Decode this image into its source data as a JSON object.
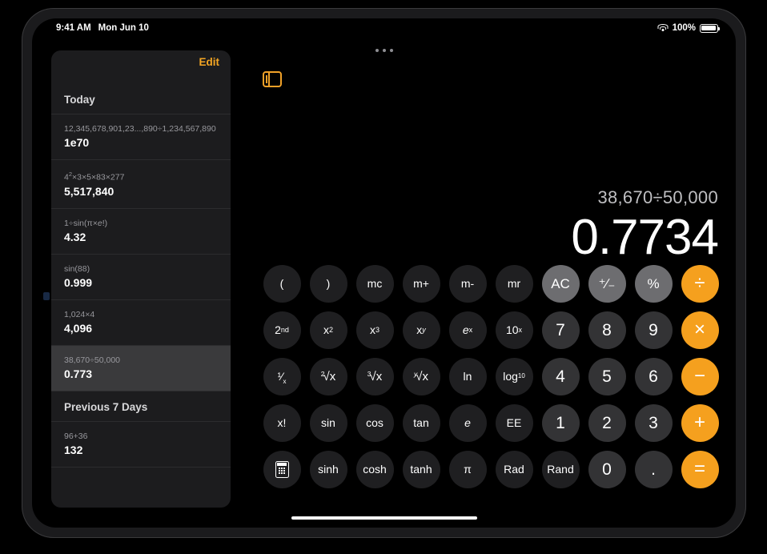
{
  "status_bar": {
    "time": "9:41 AM",
    "date": "Mon Jun 10",
    "battery_percent": "100%",
    "wifi_icon": "wifi-icon",
    "battery_icon": "battery-icon"
  },
  "multitasking": {
    "dots_icon": "multitasking-dots-icon"
  },
  "sidebar": {
    "edit_label": "Edit",
    "toggle_icon": "sidebar-toggle-icon",
    "sections": [
      {
        "title": "Today",
        "items": [
          {
            "expr": "12,345,678,901,23...,890÷1,234,567,890",
            "result": "1e70",
            "selected": false
          },
          {
            "expr_html": "4<sup>2</sup>×3×5×83×277",
            "expr": "4^2×3×5×83×277",
            "result": "5,517,840",
            "selected": false
          },
          {
            "expr_html": "1÷sin(π×<i>e</i>!)",
            "expr": "1÷sin(π×e!)",
            "result": "4.32",
            "selected": false
          },
          {
            "expr": "sin(88)",
            "result": "0.999",
            "selected": false
          },
          {
            "expr": "1,024×4",
            "result": "4,096",
            "selected": false
          },
          {
            "expr": "38,670÷50,000",
            "result": "0.773",
            "selected": true
          }
        ]
      },
      {
        "title": "Previous 7 Days",
        "items": [
          {
            "expr": "96+36",
            "result": "132",
            "selected": false
          }
        ]
      }
    ]
  },
  "display": {
    "expression": "38,670÷50,000",
    "result": "0.7734"
  },
  "keypad": {
    "rows": [
      [
        {
          "label": "(",
          "type": "fn",
          "name": "key-open-paren"
        },
        {
          "label": ")",
          "type": "fn",
          "name": "key-close-paren"
        },
        {
          "label": "mc",
          "type": "fn",
          "name": "key-memory-clear"
        },
        {
          "label": "m+",
          "type": "fn",
          "name": "key-memory-add"
        },
        {
          "label": "m-",
          "type": "fn",
          "name": "key-memory-subtract"
        },
        {
          "label": "mr",
          "type": "fn",
          "name": "key-memory-recall"
        },
        {
          "label": "AC",
          "type": "util",
          "name": "key-all-clear"
        },
        {
          "label": "⁺∕₋",
          "type": "util",
          "name": "key-plus-minus"
        },
        {
          "label": "%",
          "type": "util",
          "name": "key-percent"
        },
        {
          "label": "÷",
          "type": "op",
          "name": "key-divide"
        }
      ],
      [
        {
          "label_html": "2<sup>nd</sup>",
          "label": "2nd",
          "type": "fn",
          "name": "key-second-function"
        },
        {
          "label_html": "x<sup>2</sup>",
          "label": "x2",
          "type": "fn",
          "name": "key-x-squared"
        },
        {
          "label_html": "x<sup>3</sup>",
          "label": "x3",
          "type": "fn",
          "name": "key-x-cubed"
        },
        {
          "label_html": "x<sup><em>y</em></sup>",
          "label": "xy",
          "type": "fn",
          "name": "key-x-to-y"
        },
        {
          "label_html": "<em>e</em><sup>x</sup>",
          "label": "ex",
          "type": "fn",
          "name": "key-e-to-x"
        },
        {
          "label_html": "10<sup>x</sup>",
          "label": "10x",
          "type": "fn",
          "name": "key-ten-to-x"
        },
        {
          "label": "7",
          "type": "num",
          "name": "key-7"
        },
        {
          "label": "8",
          "type": "num",
          "name": "key-8"
        },
        {
          "label": "9",
          "type": "num",
          "name": "key-9"
        },
        {
          "label": "×",
          "type": "op",
          "name": "key-multiply"
        }
      ],
      [
        {
          "label_html": "<span class=\"frac\">¹⁄<sub>x</sub></span>",
          "label": "1/x",
          "type": "fn",
          "name": "key-reciprocal"
        },
        {
          "label_html": "<span class=\"rt\"><span class=\"idx\">2</span><span class=\"rad\">√x</span></span>",
          "label": "2√x",
          "type": "fn",
          "name": "key-square-root"
        },
        {
          "label_html": "<span class=\"rt\"><span class=\"idx\">3</span><span class=\"rad\">√x</span></span>",
          "label": "3√x",
          "type": "fn",
          "name": "key-cube-root"
        },
        {
          "label_html": "<span class=\"rt\"><span class=\"idx\"><em>y</em></span><span class=\"rad\">√x</span></span>",
          "label": "y√x",
          "type": "fn",
          "name": "key-y-root"
        },
        {
          "label": "ln",
          "type": "fn",
          "name": "key-natural-log"
        },
        {
          "label_html": "log<sub>10</sub>",
          "label": "log10",
          "type": "fn",
          "name": "key-log-base-10"
        },
        {
          "label": "4",
          "type": "num",
          "name": "key-4"
        },
        {
          "label": "5",
          "type": "num",
          "name": "key-5"
        },
        {
          "label": "6",
          "type": "num",
          "name": "key-6"
        },
        {
          "label": "−",
          "type": "op",
          "name": "key-subtract"
        }
      ],
      [
        {
          "label": "x!",
          "type": "fn",
          "name": "key-factorial"
        },
        {
          "label": "sin",
          "type": "fn",
          "name": "key-sin"
        },
        {
          "label": "cos",
          "type": "fn",
          "name": "key-cos"
        },
        {
          "label": "tan",
          "type": "fn",
          "name": "key-tan"
        },
        {
          "label_html": "<em>e</em>",
          "label": "e",
          "type": "fn",
          "name": "key-euler-number"
        },
        {
          "label": "EE",
          "type": "fn",
          "name": "key-exponent-entry"
        },
        {
          "label": "1",
          "type": "num",
          "name": "key-1"
        },
        {
          "label": "2",
          "type": "num",
          "name": "key-2"
        },
        {
          "label": "3",
          "type": "num",
          "name": "key-3"
        },
        {
          "label": "+",
          "type": "op",
          "name": "key-add"
        }
      ],
      [
        {
          "label": "",
          "type": "fn",
          "icon": "calculator-icon",
          "name": "key-calculator-mode"
        },
        {
          "label": "sinh",
          "type": "fn",
          "name": "key-sinh"
        },
        {
          "label": "cosh",
          "type": "fn",
          "name": "key-cosh"
        },
        {
          "label": "tanh",
          "type": "fn",
          "name": "key-tanh"
        },
        {
          "label": "π",
          "type": "fn",
          "name": "key-pi"
        },
        {
          "label": "Rad",
          "type": "fn",
          "name": "key-radians"
        },
        {
          "label": "Rand",
          "type": "fn",
          "name": "key-random"
        },
        {
          "label": "0",
          "type": "num",
          "name": "key-0"
        },
        {
          "label": ".",
          "type": "num",
          "name": "key-decimal-point"
        },
        {
          "label": "=",
          "type": "op",
          "name": "key-equals"
        }
      ]
    ]
  },
  "colors": {
    "accent_orange": "#f5a01e",
    "edit_orange": "#f5a623",
    "function_key": "#1f1f21",
    "number_key": "#333335",
    "utility_key": "#6d6d70",
    "sidebar_bg": "#1c1c1e",
    "selected_row": "#3a3a3c"
  },
  "home_indicator": {
    "name": "home-indicator"
  }
}
